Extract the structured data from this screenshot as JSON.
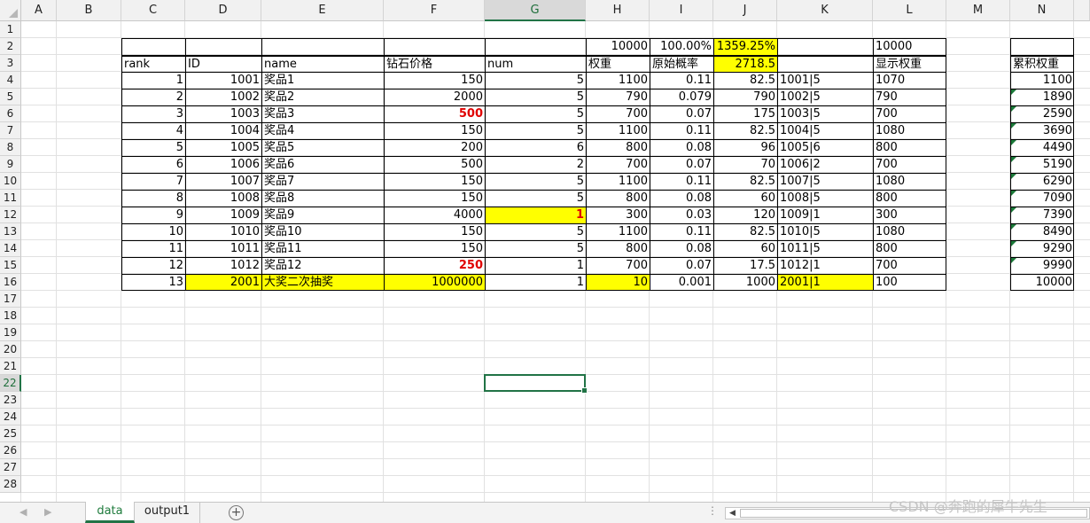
{
  "column_headers": [
    "A",
    "B",
    "C",
    "D",
    "E",
    "F",
    "G",
    "H",
    "I",
    "J",
    "K",
    "L",
    "M",
    "N"
  ],
  "row_numbers": [
    "1",
    "2",
    "3",
    "4",
    "5",
    "6",
    "7",
    "8",
    "9",
    "10",
    "11",
    "12",
    "13",
    "14",
    "15",
    "16",
    "17",
    "18",
    "19",
    "20",
    "21",
    "22",
    "23",
    "24",
    "25",
    "26",
    "27",
    "28"
  ],
  "selected_cell": "G22",
  "row2": {
    "h": "10000",
    "i": "100.00%",
    "j": "1359.25%",
    "l": "10000"
  },
  "header_row": {
    "rank": "rank",
    "id": "ID",
    "name": "name",
    "price": "钻石价格",
    "num": "num",
    "weight": "权重",
    "orig_prob": "原始概率",
    "j_value": "2718.5",
    "display_weight": "显示权重",
    "cum_weight": "累积权重"
  },
  "rows": [
    [
      "1",
      "1001",
      "奖品1",
      "150",
      "5",
      "1100",
      "0.11",
      "82.5",
      "1001|5",
      "1070",
      "1100"
    ],
    [
      "2",
      "1002",
      "奖品2",
      "2000",
      "5",
      "790",
      "0.079",
      "790",
      "1002|5",
      "790",
      "1890"
    ],
    [
      "3",
      "1003",
      "奖品3",
      "500",
      "5",
      "700",
      "0.07",
      "175",
      "1003|5",
      "700",
      "2590"
    ],
    [
      "4",
      "1004",
      "奖品4",
      "150",
      "5",
      "1100",
      "0.11",
      "82.5",
      "1004|5",
      "1080",
      "3690"
    ],
    [
      "5",
      "1005",
      "奖品5",
      "200",
      "6",
      "800",
      "0.08",
      "96",
      "1005|6",
      "800",
      "4490"
    ],
    [
      "6",
      "1006",
      "奖品6",
      "500",
      "2",
      "700",
      "0.07",
      "70",
      "1006|2",
      "700",
      "5190"
    ],
    [
      "7",
      "1007",
      "奖品7",
      "150",
      "5",
      "1100",
      "0.11",
      "82.5",
      "1007|5",
      "1080",
      "6290"
    ],
    [
      "8",
      "1008",
      "奖品8",
      "150",
      "5",
      "800",
      "0.08",
      "60",
      "1008|5",
      "800",
      "7090"
    ],
    [
      "9",
      "1009",
      "奖品9",
      "4000",
      "1",
      "300",
      "0.03",
      "120",
      "1009|1",
      "300",
      "7390"
    ],
    [
      "10",
      "1010",
      "奖品10",
      "150",
      "5",
      "1100",
      "0.11",
      "82.5",
      "1010|5",
      "1080",
      "8490"
    ],
    [
      "11",
      "1011",
      "奖品11",
      "150",
      "5",
      "800",
      "0.08",
      "60",
      "1011|5",
      "800",
      "9290"
    ],
    [
      "12",
      "1012",
      "奖品12",
      "250",
      "1",
      "700",
      "0.07",
      "17.5",
      "1012|1",
      "700",
      "9990"
    ],
    [
      "13",
      "2001",
      "大奖二次抽奖",
      "1000000",
      "1",
      "10",
      "0.001",
      "1000",
      "2001|1",
      "100",
      "10000"
    ]
  ],
  "colors": {
    "highlight": "#ffff00",
    "accent_green": "#217346",
    "emphasis_red": "#e00000"
  },
  "sheet_tabs": [
    {
      "label": "data",
      "active": true
    },
    {
      "label": "output1",
      "active": false
    }
  ],
  "add_sheet_icon": "plus-circle-icon",
  "nav_icons": [
    "nav-prev-sheet-icon",
    "nav-next-sheet-icon"
  ],
  "watermark": "CSDN @奔跑的犀牛先生"
}
